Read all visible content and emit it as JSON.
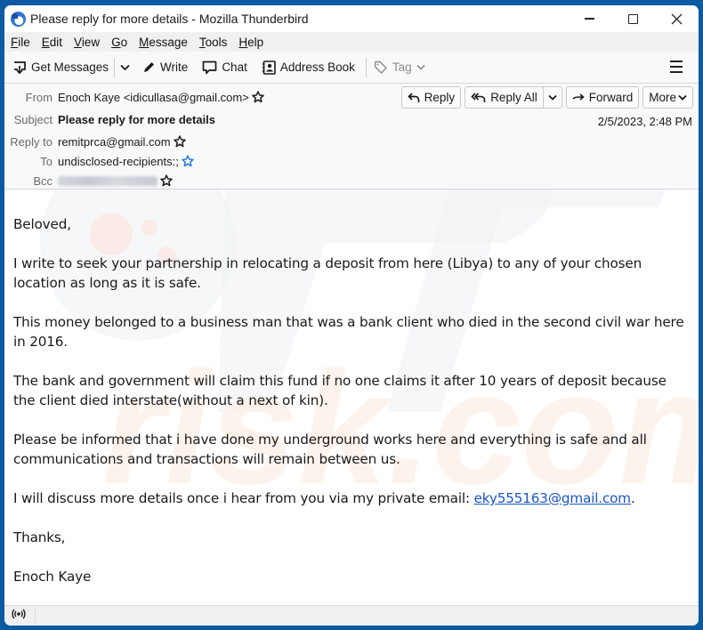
{
  "window": {
    "title": "Please reply for more details - Mozilla Thunderbird",
    "app_icon": "thunderbird-logo-icon",
    "controls": {
      "minimize": "minimize-icon",
      "maximize": "maximize-icon",
      "close": "close-icon"
    }
  },
  "menubar": {
    "items": [
      {
        "label": "File",
        "accel": "F",
        "rest": "ile"
      },
      {
        "label": "Edit",
        "accel": "E",
        "rest": "dit"
      },
      {
        "label": "View",
        "accel": "V",
        "rest": "iew"
      },
      {
        "label": "Go",
        "accel": "G",
        "rest": "o"
      },
      {
        "label": "Message",
        "accel": "M",
        "rest": "essage"
      },
      {
        "label": "Tools",
        "accel": "T",
        "rest": "ools"
      },
      {
        "label": "Help",
        "accel": "H",
        "rest": "elp"
      }
    ]
  },
  "toolbar": {
    "get_messages": "Get Messages",
    "write": "Write",
    "chat": "Chat",
    "address_book": "Address Book",
    "tag": "Tag"
  },
  "header": {
    "from_label": "From",
    "from_value": "Enoch Kaye <idicullasa@gmail.com>",
    "subject_label": "Subject",
    "subject_value": "Please reply for more details",
    "reply_to_label": "Reply to",
    "reply_to_value": "remitprca@gmail.com",
    "to_label": "To",
    "to_value": "undisclosed-recipients:;",
    "bcc_label": "Bcc",
    "bcc_value": "(redacted)",
    "date": "2/5/2023, 2:48 PM",
    "buttons": {
      "reply": "Reply",
      "reply_all": "Reply All",
      "forward": "Forward",
      "more": "More"
    }
  },
  "message": {
    "greeting": "Beloved,",
    "paragraphs": [
      "I write to seek your partnership in relocating a deposit from here (Libya) to any of your chosen location as long as it is safe.",
      "This money belonged to a business man that was a bank client who died in the second civil war here in 2016.",
      "The bank and government will claim this fund if no one claims it after 10 years of deposit because the client died interstate(without a next of kin).",
      "Please be informed that i have done my underground works here and everything is safe and all communications and transactions will remain between us."
    ],
    "contact_prefix": "I will discuss more details once i hear from you via my private email: ",
    "contact_email": "eky555163@gmail.com",
    "contact_suffix": ".",
    "closing": "Thanks,",
    "signature": "Enoch Kaye"
  },
  "statusbar": {
    "icon": "online-status-icon"
  },
  "colors": {
    "frame": "#0b5aa2",
    "link": "#1a56c9",
    "star_blue": "#2a7ae2"
  }
}
